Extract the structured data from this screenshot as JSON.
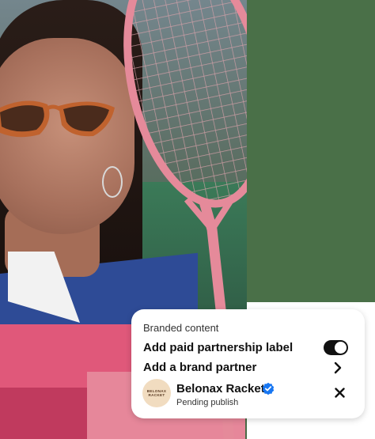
{
  "branded_content": {
    "section_title": "Branded content",
    "paid_partnership_label": "Add paid partnership label",
    "paid_partnership_enabled": true,
    "brand_partner_label": "Add a brand partner",
    "partner": {
      "logo_text_line1": "BELONAX",
      "logo_text_line2": "RACKET",
      "name": "Belonax Racket",
      "verified": true,
      "status": "Pending publish"
    }
  },
  "icons": {
    "toggle": "toggle-switch-icon",
    "chevron": "chevron-right-icon",
    "verified": "verified-badge-icon",
    "close": "close-icon"
  },
  "colors": {
    "panel_green": "#4a7048",
    "verified_blue": "#1877f2",
    "toggle_on": "#111111",
    "racket_pink": "#e58a9a"
  }
}
